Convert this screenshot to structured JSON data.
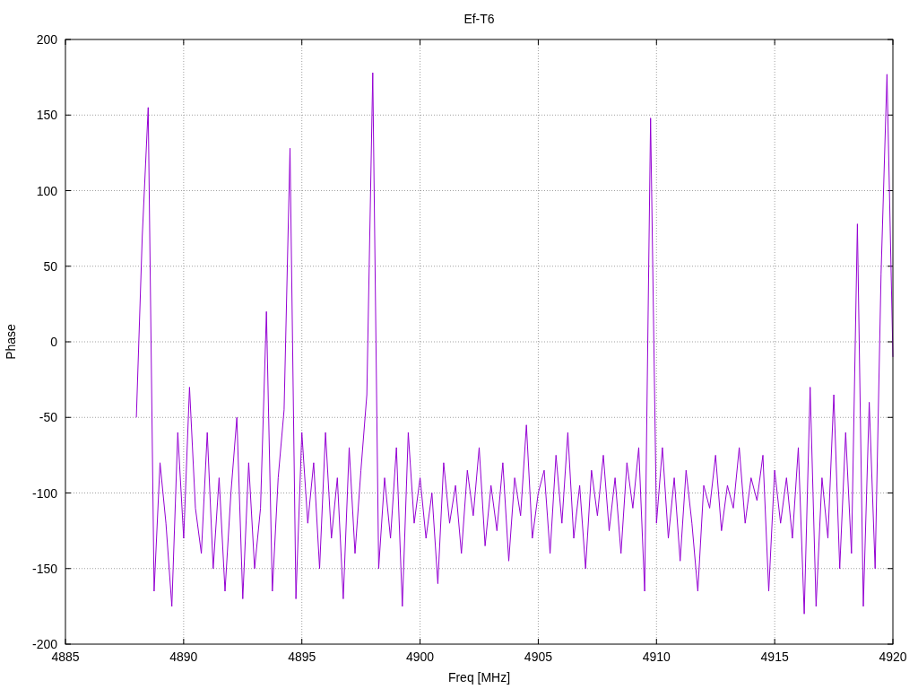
{
  "chart_data": {
    "type": "line",
    "grid": true,
    "title": "Ef-T6",
    "xlabel": "Freq [MHz]",
    "ylabel": "Phase",
    "xlim": [
      4885,
      4920
    ],
    "ylim": [
      -200,
      200
    ],
    "xticks": [
      4885,
      4890,
      4895,
      4900,
      4905,
      4910,
      4915,
      4920
    ],
    "yticks": [
      -200,
      -150,
      -100,
      -50,
      0,
      50,
      100,
      150,
      200
    ],
    "x": [
      4888,
      4888.25,
      4888.5,
      4888.75,
      4889,
      4889.25,
      4889.5,
      4889.75,
      4890,
      4890.25,
      4890.5,
      4890.75,
      4891,
      4891.25,
      4891.5,
      4891.75,
      4892,
      4892.25,
      4892.5,
      4892.75,
      4893,
      4893.25,
      4893.5,
      4893.75,
      4894,
      4894.25,
      4894.5,
      4894.75,
      4895,
      4895.25,
      4895.5,
      4895.75,
      4896,
      4896.25,
      4896.5,
      4896.75,
      4897,
      4897.25,
      4897.5,
      4897.75,
      4898,
      4898.25,
      4898.5,
      4898.75,
      4899,
      4899.25,
      4899.5,
      4899.75,
      4900,
      4900.25,
      4900.5,
      4900.75,
      4901,
      4901.25,
      4901.5,
      4901.75,
      4902,
      4902.25,
      4902.5,
      4902.75,
      4903,
      4903.25,
      4903.5,
      4903.75,
      4904,
      4904.25,
      4904.5,
      4904.75,
      4905,
      4905.25,
      4905.5,
      4905.75,
      4906,
      4906.25,
      4906.5,
      4906.75,
      4907,
      4907.25,
      4907.5,
      4907.75,
      4908,
      4908.25,
      4908.5,
      4908.75,
      4909,
      4909.25,
      4909.5,
      4909.75,
      4910,
      4910.25,
      4910.5,
      4910.75,
      4911,
      4911.25,
      4911.5,
      4911.75,
      4912,
      4912.25,
      4912.5,
      4912.75,
      4913,
      4913.25,
      4913.5,
      4913.75,
      4914,
      4914.25,
      4914.5,
      4914.75,
      4915,
      4915.25,
      4915.5,
      4915.75,
      4916,
      4916.25,
      4916.5,
      4916.75,
      4917,
      4917.25,
      4917.5,
      4917.75,
      4918,
      4918.25,
      4918.5,
      4918.75,
      4919,
      4919.25,
      4919.5,
      4919.75,
      4920
    ],
    "series": [
      {
        "color": "#9400d3",
        "values": [
          -50,
          70,
          155,
          -165,
          -80,
          -120,
          -175,
          -60,
          -130,
          -30,
          -110,
          -140,
          -60,
          -150,
          -90,
          -165,
          -100,
          -50,
          -170,
          -80,
          -150,
          -110,
          20,
          -165,
          -90,
          -45,
          128,
          -170,
          -60,
          -120,
          -80,
          -150,
          -60,
          -130,
          -90,
          -170,
          -70,
          -140,
          -85,
          -35,
          178,
          -150,
          -90,
          -130,
          -70,
          -175,
          -60,
          -120,
          -90,
          -130,
          -100,
          -160,
          -80,
          -120,
          -95,
          -140,
          -85,
          -115,
          -70,
          -135,
          -95,
          -125,
          -80,
          -145,
          -90,
          -115,
          -55,
          -130,
          -100,
          -85,
          -140,
          -75,
          -120,
          -60,
          -130,
          -95,
          -150,
          -85,
          -115,
          -75,
          -125,
          -90,
          -140,
          -80,
          -110,
          -70,
          -165,
          148,
          -120,
          -70,
          -130,
          -90,
          -145,
          -85,
          -120,
          -165,
          -95,
          -110,
          -75,
          -125,
          -95,
          -110,
          -70,
          -120,
          -90,
          -105,
          -75,
          -165,
          -85,
          -120,
          -90,
          -130,
          -70,
          -180,
          -30,
          -175,
          -90,
          -130,
          -35,
          -150,
          -60,
          -140,
          78,
          -175,
          -40,
          -150,
          45,
          177,
          -10
        ]
      }
    ]
  }
}
